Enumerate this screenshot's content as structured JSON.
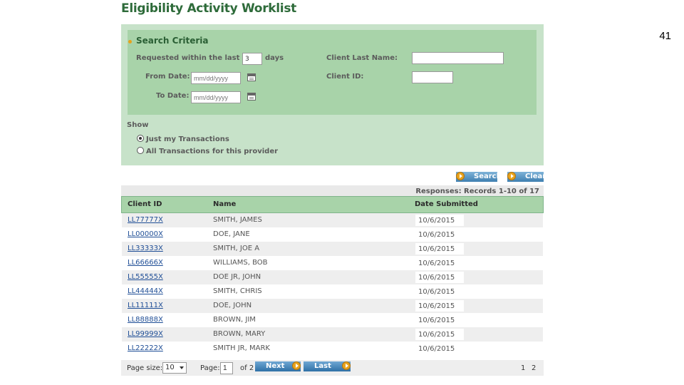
{
  "page": {
    "title": "Eligibility Activity Worklist",
    "slide_number": "41"
  },
  "search_criteria": {
    "title": "Search Criteria",
    "requested_within_label": "Requested within the last",
    "requested_within_value": "3",
    "days_label": "days",
    "from_date_label": "From Date:",
    "to_date_label": "To Date:",
    "date_placeholder": "mm/dd/yyyy",
    "client_last_name_label": "Client Last Name:",
    "client_last_name_value": "",
    "client_id_label": "Client ID:",
    "client_id_value": ""
  },
  "show": {
    "label": "Show",
    "options": [
      {
        "label": "Just my Transactions",
        "selected": true
      },
      {
        "label": "All Transactions for this provider",
        "selected": false
      }
    ]
  },
  "actions": {
    "search_label": "Search",
    "clear_label": "Clear"
  },
  "results": {
    "summary": "Responses: Records 1-10 of 17",
    "columns": [
      "Client ID",
      "Name",
      "Date Submitted"
    ],
    "rows": [
      {
        "client_id": "LL77777X",
        "name": "SMITH, JAMES",
        "date": "10/6/2015"
      },
      {
        "client_id": "LL00000X",
        "name": "DOE, JANE",
        "date": "10/6/2015"
      },
      {
        "client_id": "LL33333X",
        "name": "SMITH, JOE A",
        "date": "10/6/2015"
      },
      {
        "client_id": "LL66666X",
        "name": "WILLIAMS, BOB",
        "date": "10/6/2015"
      },
      {
        "client_id": "LL55555X",
        "name": "DOE JR, JOHN",
        "date": "10/6/2015"
      },
      {
        "client_id": "LL44444X",
        "name": "SMITH, CHRIS",
        "date": "10/6/2015"
      },
      {
        "client_id": "LL11111X",
        "name": "DOE, JOHN",
        "date": "10/6/2015"
      },
      {
        "client_id": "LL88888X",
        "name": "BROWN, JIM",
        "date": "10/6/2015"
      },
      {
        "client_id": "LL99999X",
        "name": "BROWN, MARY",
        "date": "10/6/2015"
      },
      {
        "client_id": "LL22222X",
        "name": "SMITH JR, MARK",
        "date": "10/6/2015"
      }
    ]
  },
  "pager": {
    "page_size_label": "Page size:",
    "page_size_value": "10",
    "page_label": "Page:",
    "page_value": "1",
    "of_label": "of 2",
    "next_label": "Next",
    "last_label": "Last",
    "page_links": [
      "1",
      "2"
    ]
  },
  "colors": {
    "panel_outer": "#c7e2c9",
    "panel_inner": "#a8d3a9",
    "title_green": "#2e6b3a",
    "link_blue": "#1f4e96",
    "accent_orange": "#e8a31c",
    "button_blue": "#3f7fb0"
  },
  "icons": [
    "calendar-icon",
    "arrow-circle-icon",
    "chevron-down-icon"
  ]
}
